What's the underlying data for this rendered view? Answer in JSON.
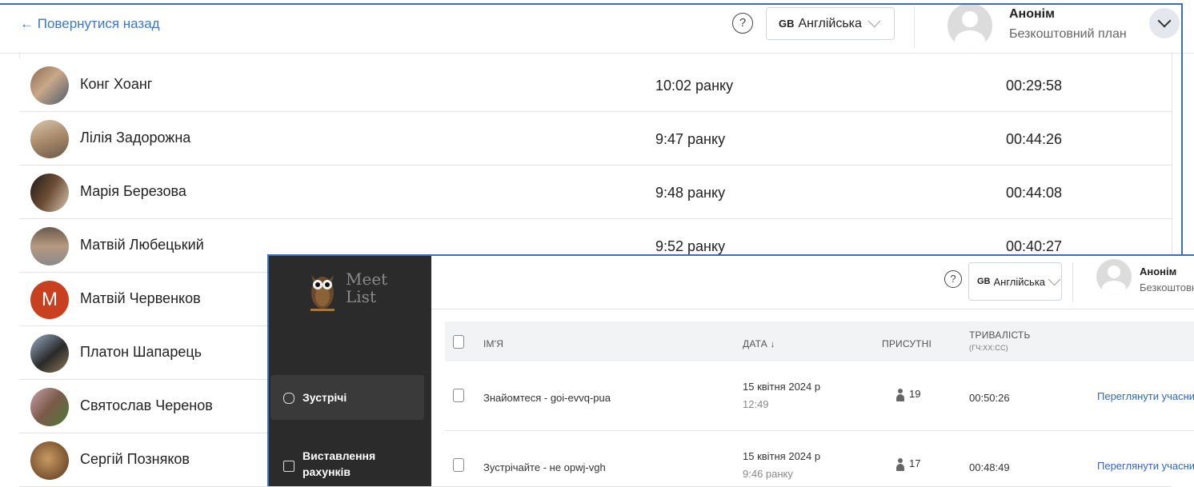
{
  "back_window": {
    "back_link": "← Повернутися назад",
    "help": "?",
    "language": "Англійська",
    "language_code": "GB",
    "user": {
      "name": "Анонім",
      "plan": "Безкоштовний план"
    },
    "participants": [
      {
        "name": "Конг Хоанг",
        "joined": "10:02 ранку",
        "duration": "00:29:58",
        "avatar": "photo"
      },
      {
        "name": "Лілія Задорожна",
        "joined": "9:47 ранку",
        "duration": "00:44:26",
        "avatar": "photo"
      },
      {
        "name": "Марія Березова",
        "joined": "9:48 ранку",
        "duration": "00:44:08",
        "avatar": "photo"
      },
      {
        "name": "Матвій Любецький",
        "joined": "9:52 ранку",
        "duration": "00:40:27",
        "avatar": "photo"
      },
      {
        "name": "Матвій Червенков",
        "joined": "",
        "duration": "",
        "avatar": "M"
      },
      {
        "name": "Платон Шапарець",
        "joined": "",
        "duration": "",
        "avatar": "photo"
      },
      {
        "name": "Святослав Черенов",
        "joined": "",
        "duration": "",
        "avatar": "photo"
      },
      {
        "name": "Сергій Позняков",
        "joined": "",
        "duration": "",
        "avatar": "photo"
      }
    ]
  },
  "front_window": {
    "logo": {
      "line1": "Meet",
      "line2": "List"
    },
    "help": "?",
    "language": "Англійська",
    "language_code": "GB",
    "user": {
      "name": "Анонім",
      "plan": "Безкоштовни"
    },
    "nav": [
      {
        "label": "Зустрічі",
        "active": true,
        "icon": "meetings-icon"
      },
      {
        "label_line1": "Виставлення",
        "label_line2": "рахунків",
        "active": false,
        "icon": "billing-icon"
      }
    ],
    "table": {
      "headers": {
        "name": "ІМ'Я",
        "date": "ДАТА",
        "sort_arrow": "↓",
        "present": "ПРИСУТНІ",
        "duration": "ТРИВАЛІСТЬ",
        "duration_unit": "(ГЧ:ХХ:СС)"
      },
      "rows": [
        {
          "name": "Знайомтеся - goi-evvq-pua",
          "date": "15 квітня 2024 р",
          "time": "12:49",
          "present": "19",
          "duration": "00:50:26",
          "action": "Переглянути учасникі"
        },
        {
          "name": "Зустрічайте - не opwj-vgh",
          "date": "15 квітня 2024 р",
          "time": "9:46 ранку",
          "present": "17",
          "duration": "00:48:49",
          "action": "Переглянути учасникі"
        }
      ]
    }
  },
  "colors": {
    "link": "#3b78c4",
    "sidebar": "#2b2b2b",
    "avatar_letter_bg": "#c8401f",
    "frame": "#3b6fb6"
  }
}
